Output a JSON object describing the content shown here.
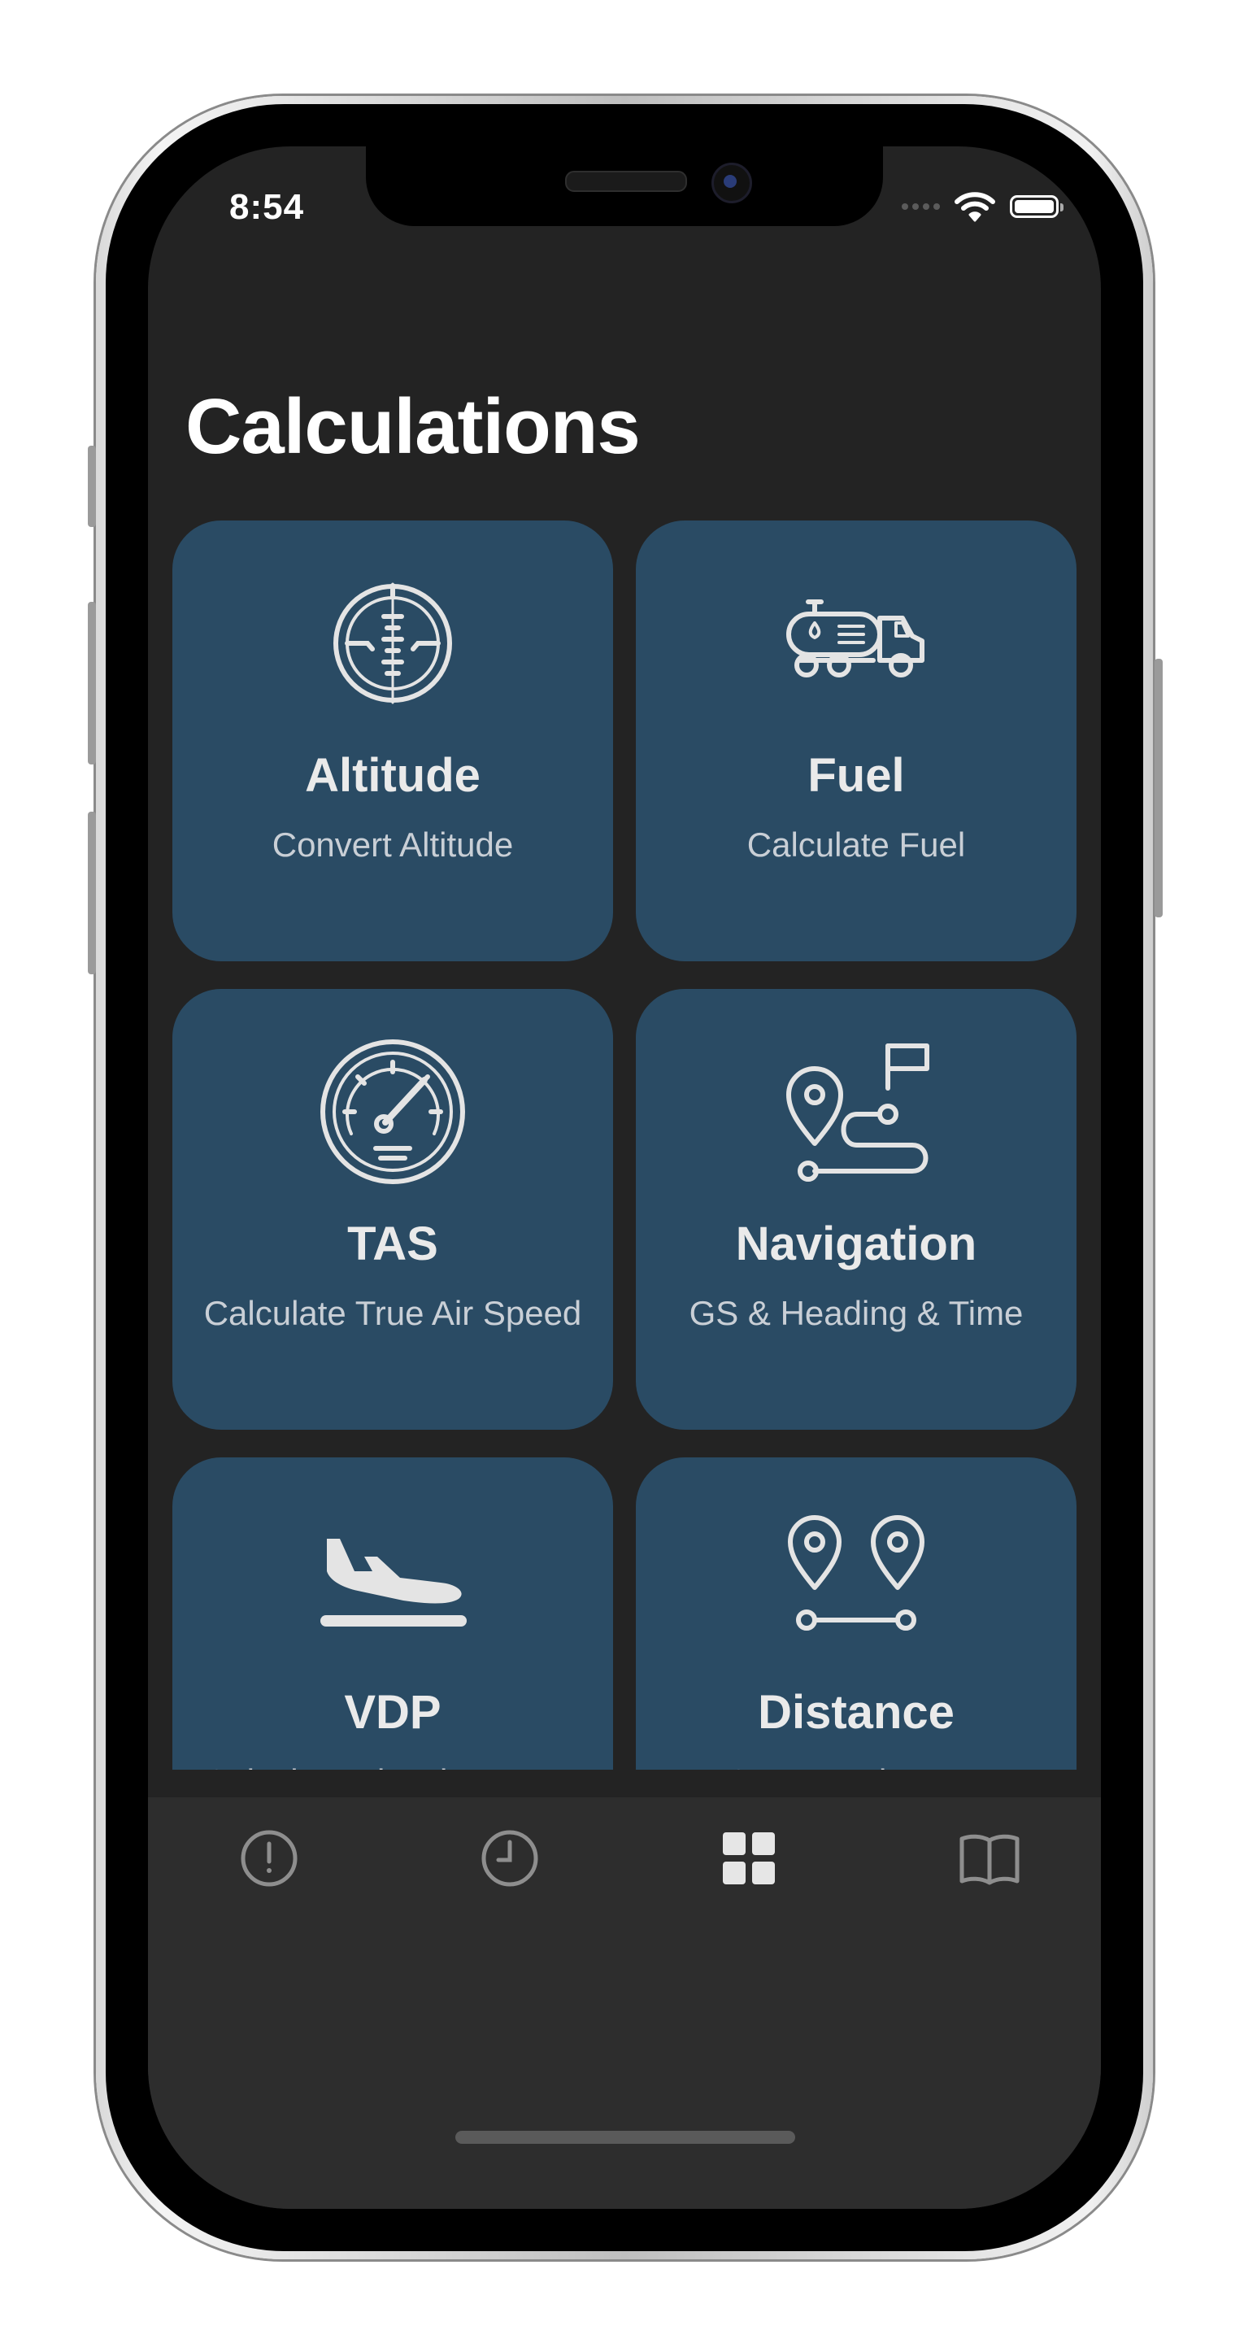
{
  "status_bar": {
    "time": "8:54"
  },
  "page": {
    "title": "Calculations"
  },
  "cards": [
    {
      "title": "Altitude",
      "subtitle": "Convert Altitude",
      "icon": "altimeter-icon"
    },
    {
      "title": "Fuel",
      "subtitle": "Calculate Fuel",
      "icon": "fuel-truck-icon"
    },
    {
      "title": "TAS",
      "subtitle": "Calculate True Air Speed",
      "icon": "speedometer-icon"
    },
    {
      "title": "Navigation",
      "subtitle": "GS & Heading & Time",
      "icon": "route-flag-icon"
    },
    {
      "title": "VDP",
      "subtitle": "Calculate Visual Descent Point",
      "icon": "plane-landing-icon"
    },
    {
      "title": "Distance",
      "subtitle": "Convert Distance",
      "icon": "two-pins-distance-icon"
    }
  ],
  "tab_bar": {
    "items": [
      {
        "icon": "alert-circle-icon",
        "selected": false
      },
      {
        "icon": "clock-icon",
        "selected": false
      },
      {
        "icon": "grid-icon",
        "selected": true
      },
      {
        "icon": "book-icon",
        "selected": false
      }
    ]
  },
  "colors": {
    "screen_background": "#232323",
    "card_background": "#2a4b64",
    "tab_bar_background": "#2d2d2d",
    "tab_selected": "#e6e6e6",
    "tab_unselected": "#8e8e8e"
  }
}
